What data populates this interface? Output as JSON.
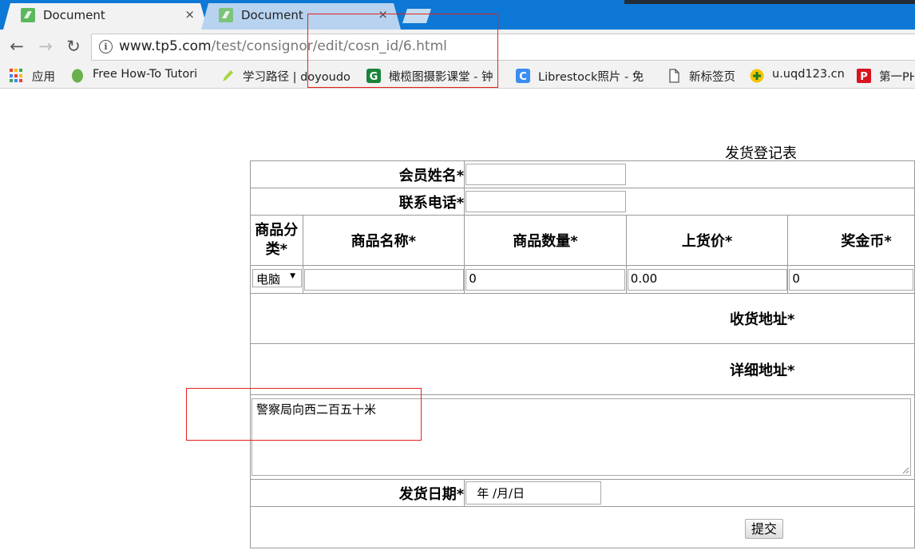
{
  "browser": {
    "tabs": [
      {
        "title": "Document",
        "active": true
      },
      {
        "title": "Document",
        "active": false
      }
    ],
    "close_glyph": "×",
    "url_host": "www.tp5.com",
    "url_path": "/test/consignor/edit/cosn_id/6.html",
    "nav": {
      "back": "←",
      "forward": "→",
      "reload": "↻"
    },
    "bookmarks": [
      {
        "label": "应用",
        "icon": "apps-grid-icon"
      },
      {
        "label": "Free How-To Tutori",
        "icon": "leaf-icon"
      },
      {
        "label": "学习路径 | doyoudo",
        "icon": "pencil-icon"
      },
      {
        "label": "橄榄图摄影课堂 - 钟",
        "icon": "g-logo-icon"
      },
      {
        "label": "Librestock照片 - 免",
        "icon": "c-logo-icon"
      },
      {
        "label": "新标签页",
        "icon": "page-icon"
      },
      {
        "label": "u.uqd123.cn",
        "icon": "plus-circle-icon"
      },
      {
        "label": "第一PH",
        "icon": "p-logo-icon"
      }
    ]
  },
  "form": {
    "title": "发货登记表",
    "member_name_label": "会员姓名*",
    "phone_label": "联系电话*",
    "headers": [
      "商品分类*",
      "商品名称*",
      "商品数量*",
      "上货价*",
      "奖金币*"
    ],
    "category_selected": "电脑",
    "row_values": {
      "name": "",
      "quantity": "0",
      "price": "0.00",
      "bonus": "0"
    },
    "receive_address_label": "收货地址*",
    "detail_address_label": "详细地址*",
    "address_text": "警察局向西二百五十米",
    "ship_date_label": "发货日期*",
    "ship_date_value": "年 /月/日",
    "submit_label": "提交"
  },
  "colors": {
    "tabstrip": "#0d78d6",
    "highlight": "#e3221d"
  }
}
